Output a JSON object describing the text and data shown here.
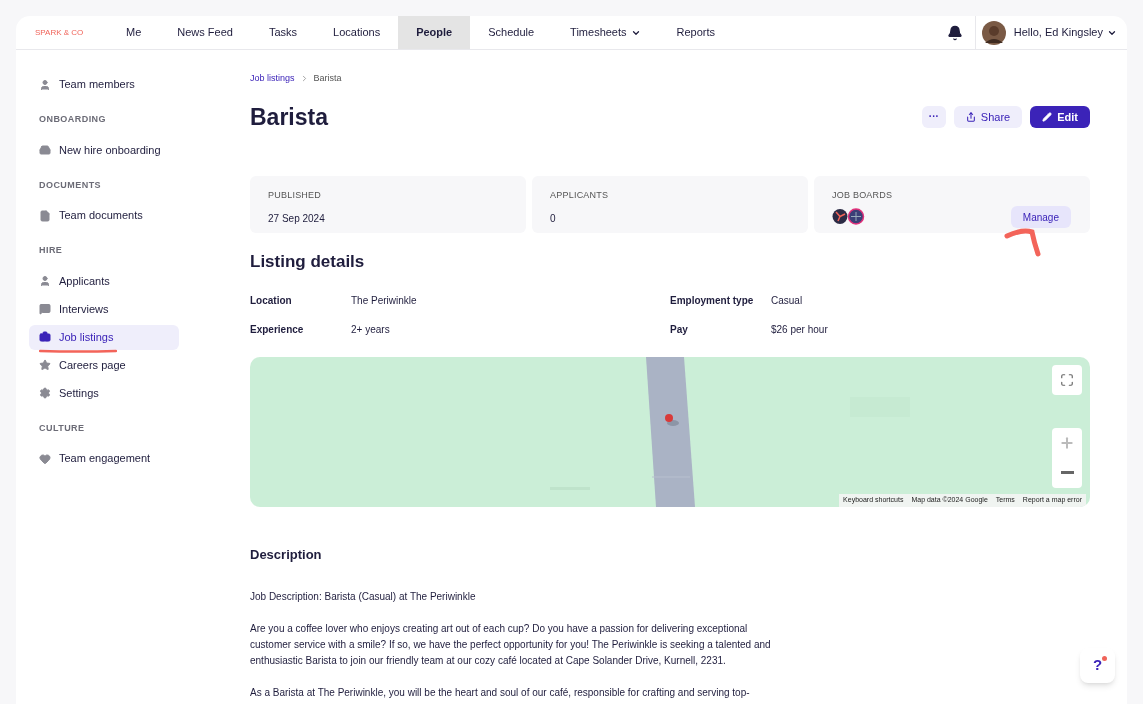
{
  "brand": "SPARK & CO",
  "nav": [
    {
      "label": "Me",
      "selected": false,
      "dropdown": false
    },
    {
      "label": "News Feed",
      "selected": false,
      "dropdown": false
    },
    {
      "label": "Tasks",
      "selected": false,
      "dropdown": false
    },
    {
      "label": "Locations",
      "selected": false,
      "dropdown": false
    },
    {
      "label": "People",
      "selected": true,
      "dropdown": false
    },
    {
      "label": "Schedule",
      "selected": false,
      "dropdown": false
    },
    {
      "label": "Timesheets",
      "selected": false,
      "dropdown": true
    },
    {
      "label": "Reports",
      "selected": false,
      "dropdown": false
    }
  ],
  "user": {
    "greeting": "Hello, Ed Kingsley"
  },
  "sidebar": {
    "sections": [
      {
        "items": [
          {
            "label": "Team members",
            "kind": "person",
            "selected": false
          }
        ]
      },
      {
        "heading": "ONBOARDING",
        "items": [
          {
            "label": "New hire onboarding",
            "kind": "inbox",
            "selected": false
          }
        ]
      },
      {
        "heading": "DOCUMENTS",
        "items": [
          {
            "label": "Team documents",
            "kind": "document",
            "selected": false
          }
        ]
      },
      {
        "heading": "HIRE",
        "items": [
          {
            "label": "Applicants",
            "kind": "person",
            "selected": false
          },
          {
            "label": "Interviews",
            "kind": "chat",
            "selected": false
          },
          {
            "label": "Job listings",
            "kind": "briefcase",
            "selected": true
          },
          {
            "label": "Careers page",
            "kind": "star",
            "selected": false
          },
          {
            "label": "Settings",
            "kind": "gear",
            "selected": false
          }
        ]
      },
      {
        "heading": "CULTURE",
        "items": [
          {
            "label": "Team engagement",
            "kind": "heart",
            "selected": false
          }
        ]
      }
    ]
  },
  "breadcrumb": [
    "Job listings",
    "Barista"
  ],
  "title": "Barista",
  "actions": {
    "more": "···",
    "share": "Share",
    "edit": "Edit"
  },
  "stats": [
    {
      "kind": "text",
      "label": "PUBLISHED",
      "value": "27 Sep 2024"
    },
    {
      "kind": "text",
      "label": "APPLICANTS",
      "value": "0"
    },
    {
      "kind": "boards",
      "label": "JOB BOARDS",
      "button": "Manage"
    }
  ],
  "details": {
    "heading": "Listing details",
    "fields": [
      {
        "label": "Location",
        "value": "The Periwinkle"
      },
      {
        "label": "Employment type",
        "value": "Casual"
      },
      {
        "label": "Experience",
        "value": "2+ years"
      },
      {
        "label": "Pay",
        "value": "$26 per hour"
      }
    ]
  },
  "map": {
    "kind": "picture",
    "attribution": [
      "Keyboard shortcuts",
      "Map data ©2024 Google",
      "Terms",
      "Report a map error"
    ]
  },
  "description": {
    "heading": "Description",
    "paragraphs": [
      "Job Description: Barista (Casual) at The Periwinkle",
      "Are you a coffee lover who enjoys creating art out of each cup? Do you have a passion for delivering exceptional customer service with a smile? If so, we have the perfect opportunity for you! The Periwinkle is seeking a talented and enthusiastic Barista to join our friendly team at our cozy café located at Cape Solander Drive, Kurnell, 2231.",
      "As a Barista at The Periwinkle, you will be the heart and soul of our café, responsible for crafting and serving top-"
    ]
  },
  "help": {
    "label": "?",
    "notification": true
  }
}
